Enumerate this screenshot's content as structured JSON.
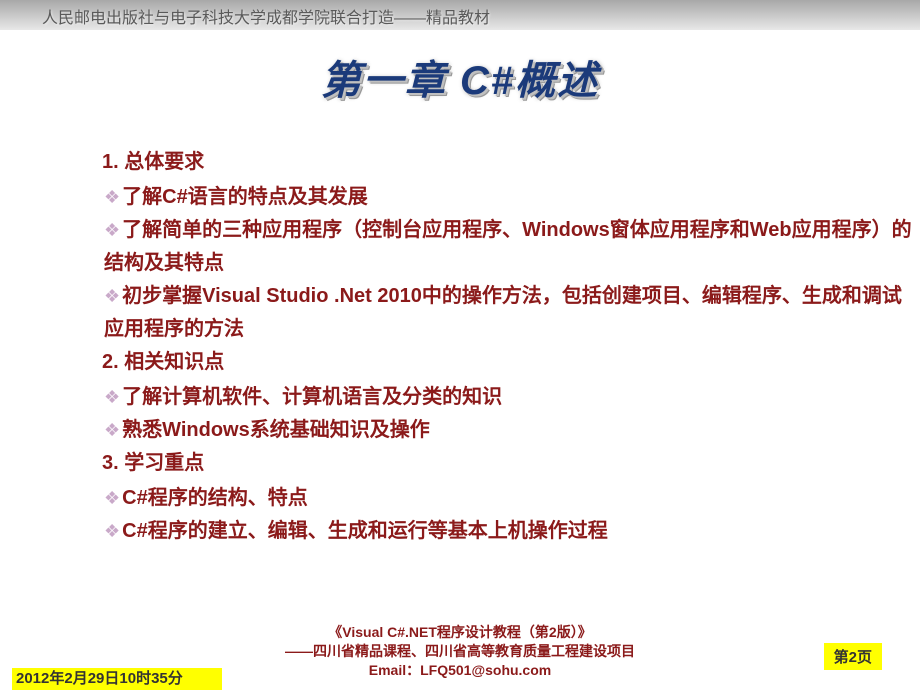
{
  "header": {
    "banner": "人民邮电出版社与电子科技大学成都学院联合打造——精品教材"
  },
  "title": "第一章 C#概述",
  "sections": [
    {
      "head": "1. 总体要求",
      "items": [
        "了解C#语言的特点及其发展",
        "了解简单的三种应用程序（控制台应用程序、Windows窗体应用程序和Web应用程序）的结构及其特点",
        "初步掌握Visual Studio .Net 2010中的操作方法，包括创建项目、编辑程序、生成和调试应用程序的方法"
      ]
    },
    {
      "head": "2. 相关知识点",
      "items": [
        "了解计算机软件、计算机语言及分类的知识",
        "熟悉Windows系统基础知识及操作"
      ]
    },
    {
      "head": "3. 学习重点",
      "items": [
        "C#程序的结构、特点",
        "C#程序的建立、编辑、生成和运行等基本上机操作过程"
      ]
    }
  ],
  "footer": {
    "timestamp": "2012年2月29日10时35分",
    "book_title": "《Visual C#.NET程序设计教程（第2版）》",
    "subtitle": "——四川省精品课程、四川省高等教育质量工程建设项目",
    "email": "Email：LFQ501@sohu.com",
    "page": "第2页"
  }
}
